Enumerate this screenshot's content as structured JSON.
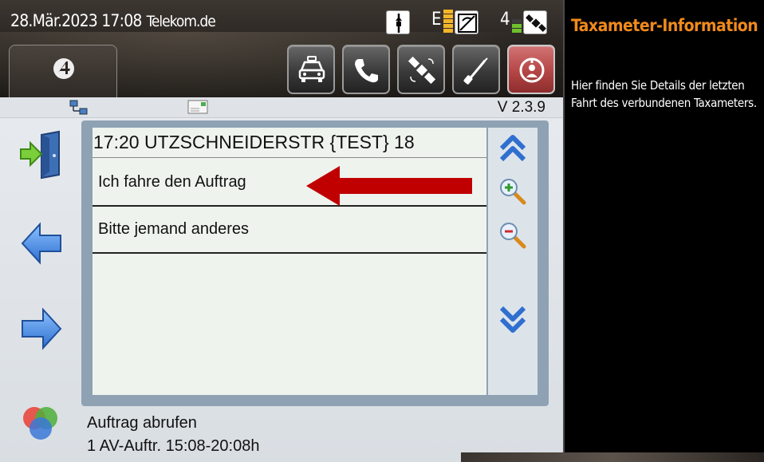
{
  "statusbar": {
    "datetime": "28.Mär.2023 17:08",
    "provider": "Telekom.de",
    "e_label": "E",
    "gps_label": "4",
    "icons": [
      "compass-icon",
      "signal-bars-icon",
      "antenna-icon",
      "satellite-icon"
    ]
  },
  "toolbar": {
    "buttons": [
      "taxi-button",
      "phone-button",
      "satellite-button",
      "tools-button",
      "profile-button"
    ]
  },
  "subbar": {
    "version": "V 2.3.9"
  },
  "list": {
    "header": "17:20 UTZSCHNEIDERSTR  {TEST} 18",
    "items": [
      {
        "label": "Ich fahre den Auftrag"
      },
      {
        "label": "Bitte jemand anderes"
      }
    ]
  },
  "status": {
    "line1": "Auftrag abrufen",
    "line2": "1 AV-Auftr. 15:08-20:08h"
  },
  "info": {
    "title": "Taxameter-Information",
    "text": "Hier finden Sie Details der letzten Fahrt des verbundenen Taxameters."
  },
  "colors": {
    "accent_orange": "#f08a1c",
    "arrow_red": "#c00000",
    "profile_red": "#b54545",
    "list_bg": "#eef3ee"
  }
}
